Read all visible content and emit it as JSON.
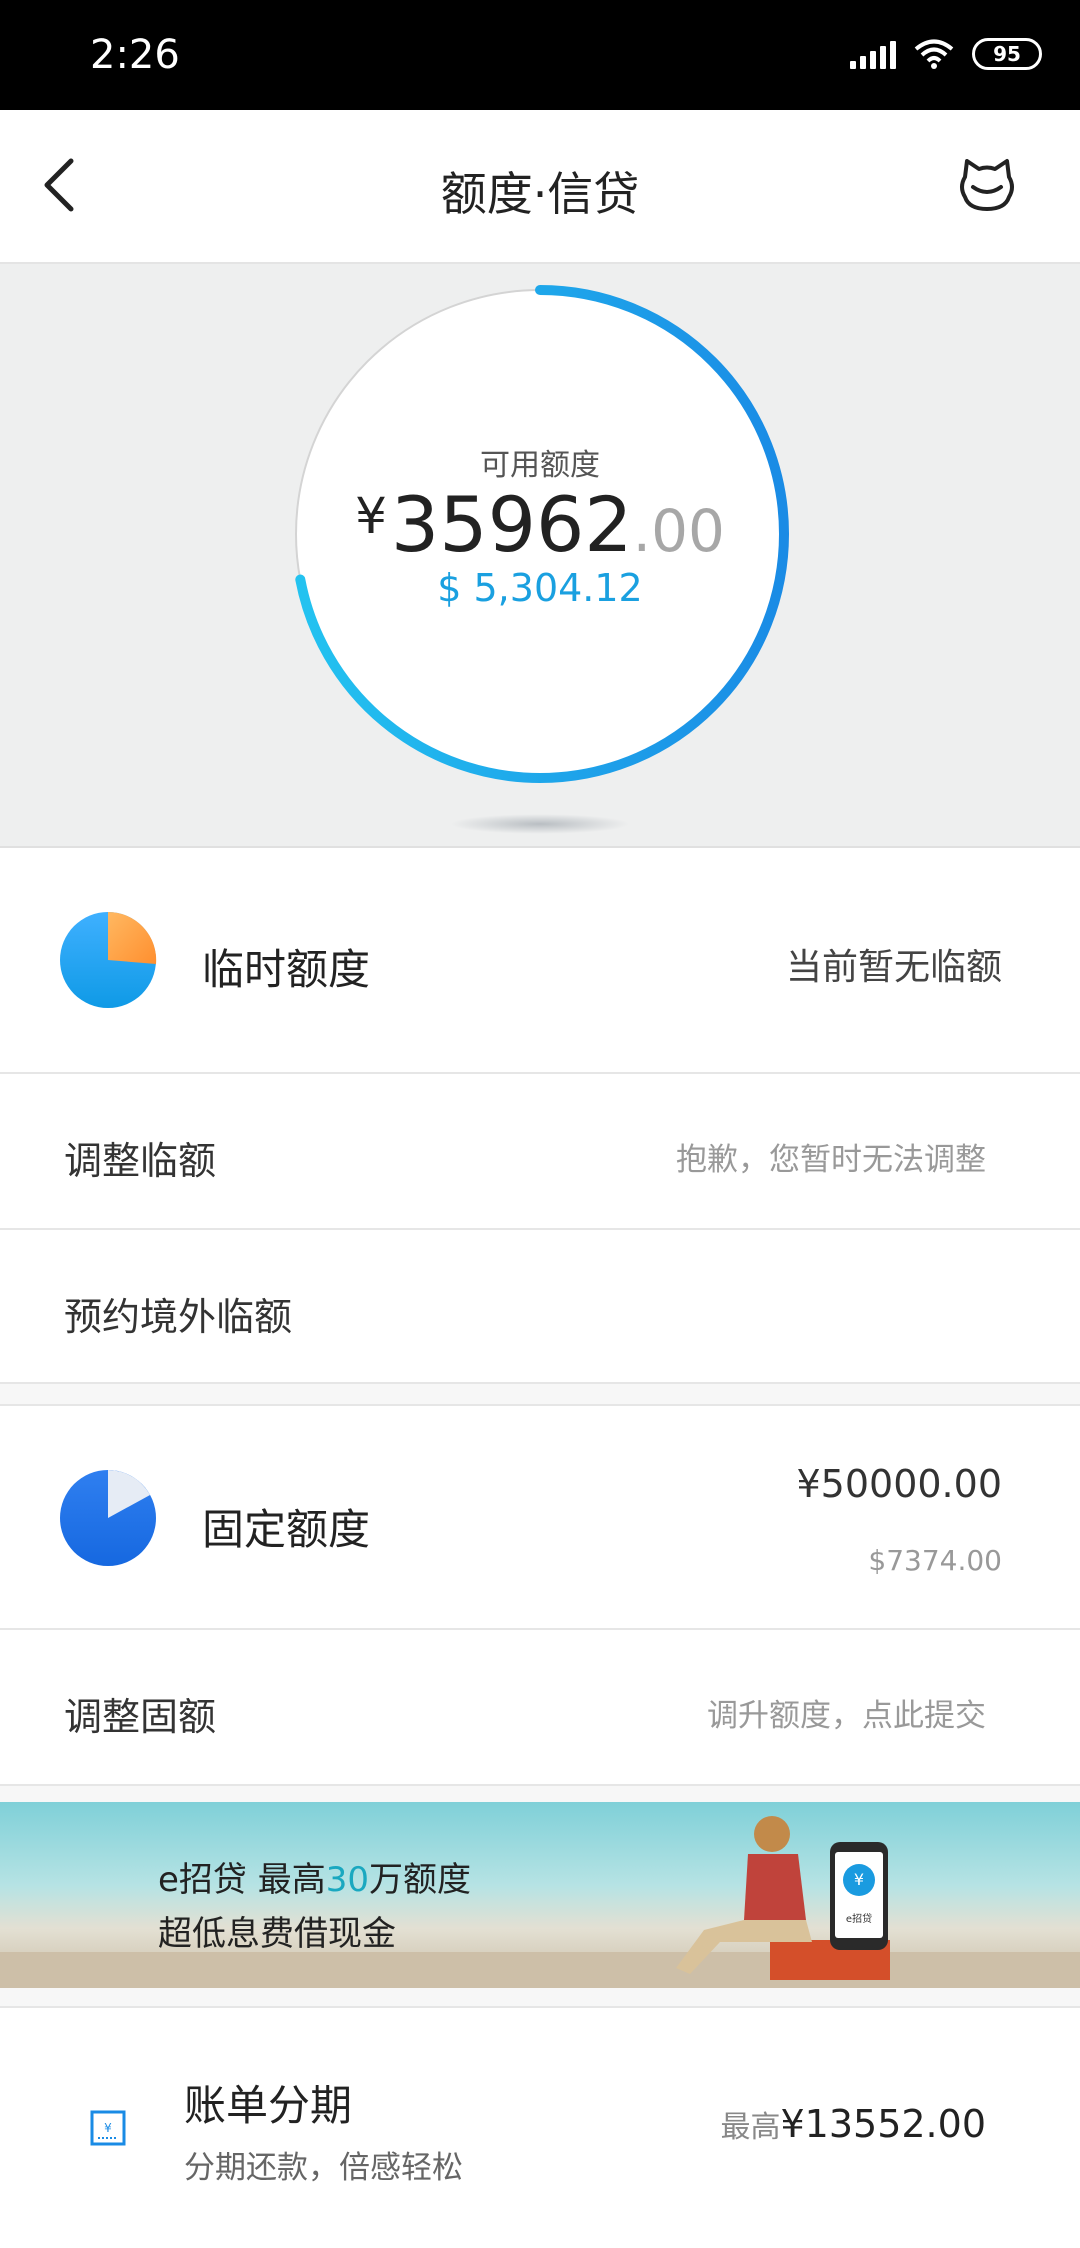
{
  "status_bar": {
    "time": "2:26",
    "battery": "95"
  },
  "nav": {
    "title": "额度·信贷",
    "back_icon": "chevron-left-icon",
    "service_icon": "cat-service-icon"
  },
  "available": {
    "label": "可用额度",
    "currency": "¥",
    "integer": "35962",
    "decimal": ".00",
    "usd": "$ 5,304.12",
    "ring_progress": 0.72,
    "ring_color_start": "#23c3f0",
    "ring_color_end": "#1a8be5"
  },
  "temp_limit": {
    "title": "临时额度",
    "status": "当前暂无临额",
    "icon": "pie-chart-icon"
  },
  "adjust_temp": {
    "label": "调整临额",
    "hint": "抱歉，您暂时无法调整"
  },
  "reserve_overseas": {
    "label": "预约境外临额"
  },
  "fixed_limit": {
    "title": "固定额度",
    "cny": "¥50000.00",
    "usd": "$7374.00",
    "icon": "pie-chart-icon"
  },
  "adjust_fixed": {
    "label": "调整固额",
    "hint": "调升额度，点此提交"
  },
  "banner": {
    "line1_prefix": "e招贷  最高",
    "line1_highlight": "30",
    "line1_suffix": "万额度",
    "line2": "超低息费借现金",
    "phone_logo": "¥",
    "phone_text": "e招贷"
  },
  "installment": {
    "title": "账单分期",
    "subtitle": "分期还款，倍感轻松",
    "amount_prefix": "最高",
    "amount": "¥13552.00",
    "icon": "bill-icon",
    "icon_symbol": "¥"
  },
  "colors": {
    "accent": "#1aa0e0",
    "pie_orange": "#ffa64d",
    "pie_blue": "#1e90ff"
  }
}
